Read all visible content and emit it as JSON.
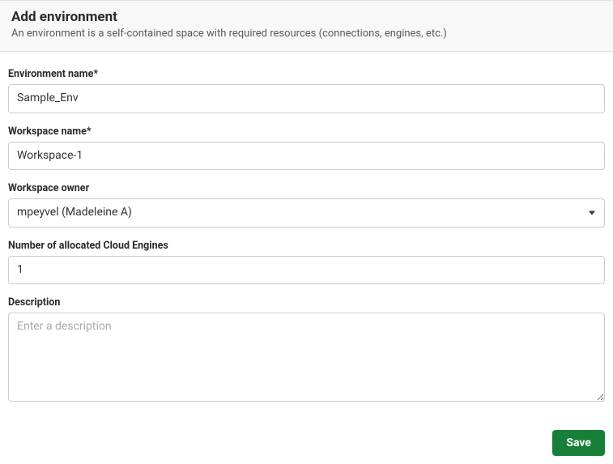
{
  "header": {
    "title": "Add environment",
    "subtitle": "An environment is a self-contained space with required resources (connections, engines, etc.)"
  },
  "form": {
    "environment_name": {
      "label": "Environment name*",
      "value": "Sample_Env"
    },
    "workspace_name": {
      "label": "Workspace name*",
      "value": "Workspace-1"
    },
    "workspace_owner": {
      "label": "Workspace owner",
      "value": "mpeyvel (Madeleine A)"
    },
    "cloud_engines": {
      "label": "Number of allocated Cloud Engines",
      "value": "1"
    },
    "description": {
      "label": "Description",
      "placeholder": "Enter a description",
      "value": ""
    }
  },
  "actions": {
    "save_label": "Save"
  }
}
